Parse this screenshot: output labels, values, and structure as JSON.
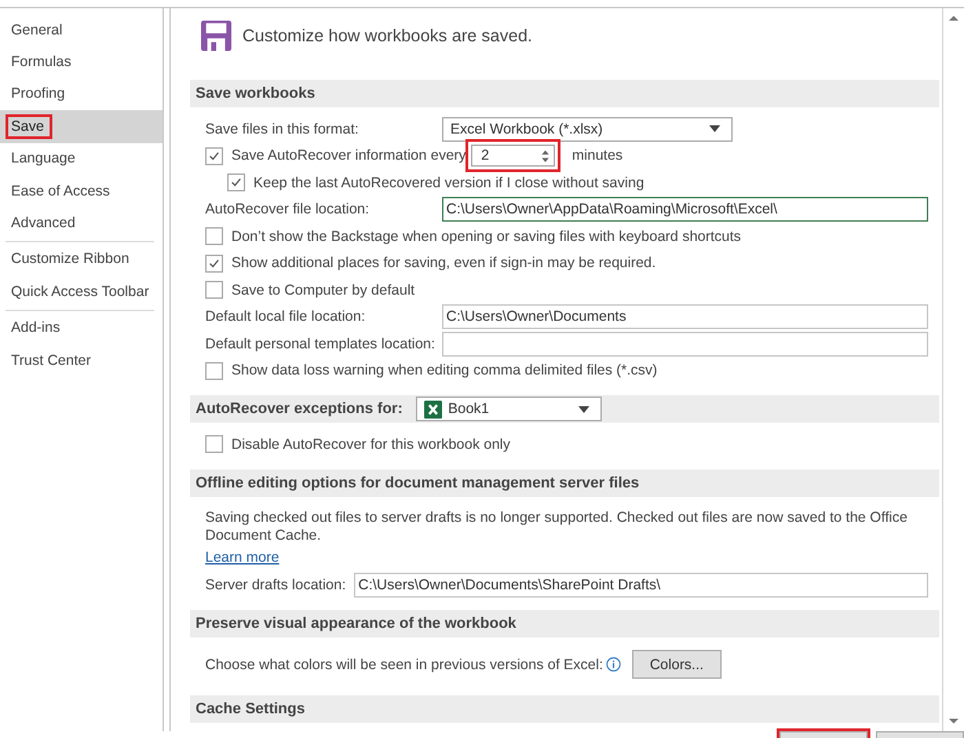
{
  "sidebar": {
    "groups": [
      [
        {
          "label": "General",
          "selected": false,
          "annotated": false
        },
        {
          "label": "Formulas",
          "selected": false,
          "annotated": false
        },
        {
          "label": "Proofing",
          "selected": false,
          "annotated": false
        },
        {
          "label": "Save",
          "selected": true,
          "annotated": true
        },
        {
          "label": "Language",
          "selected": false,
          "annotated": false
        },
        {
          "label": "Ease of Access",
          "selected": false,
          "annotated": false
        },
        {
          "label": "Advanced",
          "selected": false,
          "annotated": false
        }
      ],
      [
        {
          "label": "Customize Ribbon",
          "selected": false,
          "annotated": false
        },
        {
          "label": "Quick Access Toolbar",
          "selected": false,
          "annotated": false
        }
      ],
      [
        {
          "label": "Add-ins",
          "selected": false,
          "annotated": false
        },
        {
          "label": "Trust Center",
          "selected": false,
          "annotated": false
        }
      ]
    ]
  },
  "header": {
    "title": "Customize how workbooks are saved."
  },
  "sections": [
    {
      "title": "Save workbooks",
      "rows": [
        {
          "kind": "dropdown",
          "label": "Save files in this format:",
          "value": "Excel Workbook (*.xlsx)"
        },
        {
          "kind": "spin",
          "label": "Save AutoRecover information every",
          "checked": true,
          "value": "2",
          "unit": "minutes",
          "annotated": true,
          "children": [
            {
              "kind": "checkbox",
              "label": "Keep the last AutoRecovered version if I close without saving",
              "checked": true
            }
          ]
        },
        {
          "kind": "field",
          "label": "AutoRecover file location:",
          "value": "C:\\Users\\Owner\\AppData\\Roaming\\Microsoft\\Excel\\",
          "focused": true
        },
        {
          "kind": "checkbox",
          "label": "Don’t show the Backstage when opening or saving files with keyboard shortcuts",
          "checked": false
        },
        {
          "kind": "checkbox",
          "label": "Show additional places for saving, even if sign-in may be required.",
          "checked": true
        },
        {
          "kind": "checkbox",
          "label": "Save to Computer by default",
          "checked": false
        },
        {
          "kind": "field",
          "label": "Default local file location:",
          "value": "C:\\Users\\Owner\\Documents",
          "focused": false
        },
        {
          "kind": "field",
          "label": "Default personal templates location:",
          "focused": false
        },
        {
          "kind": "checkbox",
          "label": "Show data loss warning when editing comma delimited files (*.csv)",
          "checked": false
        }
      ]
    },
    {
      "title": "AutoRecover exceptions for:",
      "dropdown": {
        "value": "Book1"
      },
      "rows": [
        {
          "kind": "checkbox",
          "label": "Disable AutoRecover for this workbook only",
          "checked": false
        }
      ]
    },
    {
      "title": "Offline editing options for document management server files",
      "rows": [
        {
          "kind": "paragraph",
          "text": "Saving checked out files to server drafts is no longer supported. Checked out files are now saved to the Office Document Cache."
        },
        {
          "kind": "link",
          "text": "Learn more"
        },
        {
          "kind": "field",
          "label": "Server drafts location:",
          "value": "C:\\Users\\Owner\\Documents\\SharePoint Drafts\\",
          "focused": false
        }
      ]
    },
    {
      "title": "Preserve visual appearance of the workbook",
      "rows": [
        {
          "kind": "button",
          "label": "Choose what colors will be seen in previous versions of Excel:",
          "button": "Colors..."
        }
      ]
    },
    {
      "title": "Cache Settings"
    }
  ],
  "footer": {
    "buttons": [
      {
        "annotated": true
      },
      {
        "annotated": false
      }
    ]
  }
}
